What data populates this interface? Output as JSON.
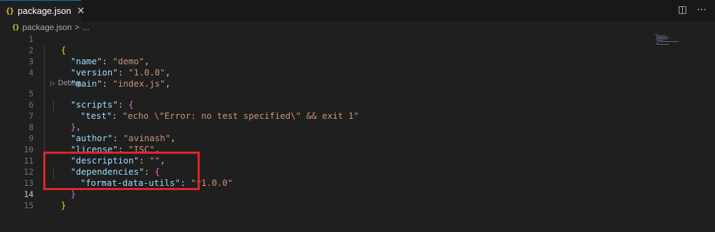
{
  "tab": {
    "icon": "{}",
    "label": "package.json"
  },
  "breadcrumb": {
    "icon": "{}",
    "file": "package.json",
    "separator": ">",
    "more": "..."
  },
  "editor_actions": {
    "split_icon": "split-editor-icon",
    "more_icon": "more-actions-icon"
  },
  "codelens": {
    "label": "Debug"
  },
  "line_numbers": [
    "1",
    "2",
    "3",
    "4",
    "5",
    "6",
    "7",
    "8",
    "9",
    "10",
    "11",
    "12",
    "13",
    "14",
    "15"
  ],
  "active_line": "14",
  "code": {
    "l1": "{",
    "name_key": "\"name\"",
    "name_val": "\"demo\"",
    "version_key": "\"version\"",
    "version_val": "\"1.0.0\"",
    "main_key": "\"main\"",
    "main_val": "\"index.js\"",
    "scripts_key": "\"scripts\"",
    "scripts_open": "{",
    "test_key": "\"test\"",
    "test_val": "\"echo \\\"Error: no test specified\\\" && exit 1\"",
    "scripts_close": "}",
    "author_key": "\"author\"",
    "author_val": "\"avinash\"",
    "license_key": "\"license\"",
    "license_val": "\"ISC\"",
    "description_key": "\"description\"",
    "description_val": "\"\"",
    "deps_key": "\"dependencies\"",
    "deps_open": "{",
    "fdu_key": "\"format-data-utils\"",
    "fdu_val": "\"^1.0.0\"",
    "deps_close": "}",
    "l14": "}"
  },
  "colors": {
    "key": "#9cdcfe",
    "string": "#ce9178",
    "brace_outer": "#ffd700",
    "brace_inner": "#da70d6",
    "highlight": "#e3242b"
  }
}
